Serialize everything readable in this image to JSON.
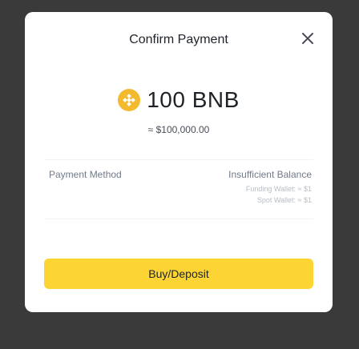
{
  "modal": {
    "title": "Confirm Payment",
    "close_icon": "close-icon"
  },
  "payment": {
    "amount": "100 BNB",
    "fiat": "≈ $100,000.00",
    "coin_icon": "bnb-coin-icon"
  },
  "method": {
    "label": "Payment Method",
    "status": "Insufficient Balance",
    "funding_wallet": "Funding Wallet: ≈ $1",
    "spot_wallet": "Spot Wallet: ≈ $1"
  },
  "action": {
    "button_label": "Buy/Deposit"
  },
  "colors": {
    "accent": "#fcd535",
    "coin": "#f3ba2f",
    "backdrop": "#3a3a3a"
  }
}
